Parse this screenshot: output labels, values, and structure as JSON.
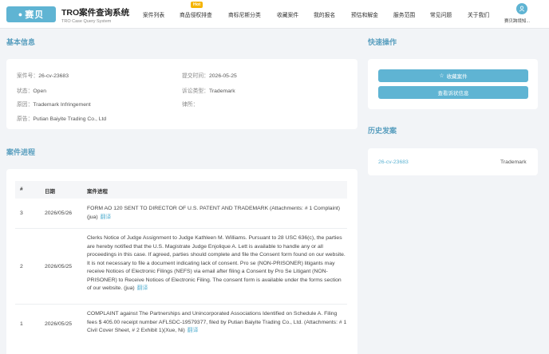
{
  "header": {
    "logo_text": "赛贝",
    "brand_title": "TRO案件查询系统",
    "brand_sub": "TRO Case Query System",
    "nav": [
      "案件列表",
      "商品侵权排查",
      "商标尼斯分类",
      "收藏案件",
      "我的报名",
      "预估和解金",
      "服务范围",
      "常见问题",
      "关于我们"
    ],
    "hot_badge": "Hot",
    "user_label": "赛贝跨境知..."
  },
  "basic": {
    "title": "基本信息",
    "case_no_label": "案件号：",
    "case_no": "26-cv-23683",
    "filed_label": "提交时间：",
    "filed": "2026-05-25",
    "status_label": "状态：",
    "status": "Open",
    "type_label": "诉讼类型：",
    "type": "Trademark",
    "cause_label": "原因：",
    "cause": "Trademark Infringement",
    "lawfirm_label": "律所：",
    "lawfirm": "",
    "plaintiff_label": "原告：",
    "plaintiff": "Putian Baiyite Trading Co., Ltd"
  },
  "quick": {
    "title": "快速操作",
    "favorite": "收藏案件",
    "complaint": "查看诉状信息"
  },
  "history": {
    "title": "历史发案",
    "items": [
      {
        "case": "26-cv-23683",
        "type": "Trademark"
      }
    ]
  },
  "progress": {
    "title": "案件进程",
    "columns": [
      "#",
      "日期",
      "案件进程"
    ],
    "translate_label": "翻译",
    "rows": [
      {
        "no": "3",
        "date": "2026/05/26",
        "text": "FORM AO 120 SENT TO DIRECTOR OF U.S. PATENT AND TRADEMARK (Attachments: # 1 Complaint) (jua)"
      },
      {
        "no": "2",
        "date": "2026/05/25",
        "text": "Clerks Notice of Judge Assignment to Judge Kathleen M. Williams. Pursuant to 28 USC 636(c), the parties are hereby notified that the U.S. Magistrate Judge Enjolique A. Lett is available to handle any or all proceedings in this case. If agreed, parties should complete and file the Consent form found on our website. It is not necessary to file a document indicating lack of consent. Pro se (NON-PRISONER) litigants may receive Notices of Electronic Filings (NEFS) via email after filing a Consent by Pro Se Litigant (NON-PRISONER) to Receive Notices of Electronic Filing. The consent form is available under the forms section of our website. (jua)"
      },
      {
        "no": "1",
        "date": "2026/05/25",
        "text": "COMPLAINT against The Partnerships and Unincorporated Associations Identified on Schedule A. Filing fees $ 405.00 receipt number AFLSDC-19579377, filed by Putian Baiyite Trading Co., Ltd. (Attachments: # 1 Civil Cover Sheet, # 2 Exhibit 1)(Xue, Ni)"
      }
    ]
  }
}
